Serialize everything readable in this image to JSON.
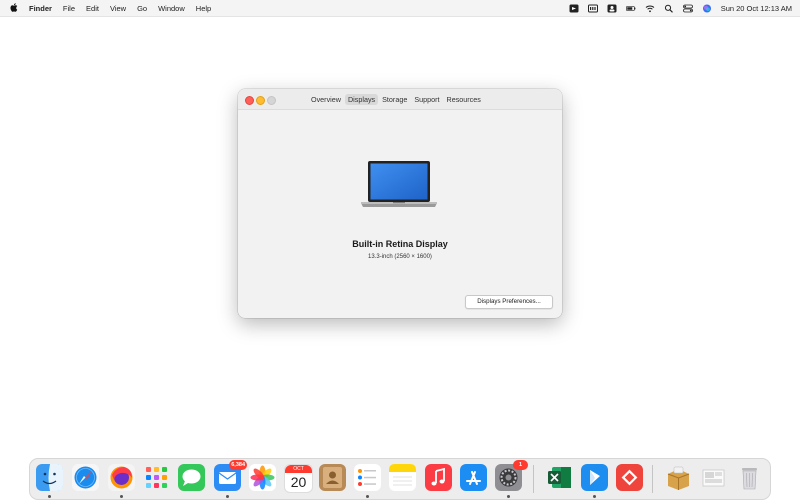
{
  "menubar": {
    "app_name": "Finder",
    "items": [
      "File",
      "Edit",
      "View",
      "Go",
      "Window",
      "Help"
    ],
    "clock": "Sun 20 Oct  12:13 AM"
  },
  "window": {
    "tabs": [
      "Overview",
      "Displays",
      "Storage",
      "Support",
      "Resources"
    ],
    "selected_tab": "Displays",
    "display_name": "Built-in Retina Display",
    "display_spec": "13.3-inch (2560 × 1600)",
    "prefs_button": "Displays Preferences..."
  },
  "dock": {
    "mail_badge": "6,384",
    "settings_badge": "1",
    "calendar_month": "OCT",
    "calendar_day": "20",
    "apps": [
      "Finder",
      "Safari",
      "Firefox",
      "Launchpad",
      "Messages",
      "Mail",
      "Photos",
      "Calendar",
      "Contacts",
      "Reminders",
      "Notes",
      "Music",
      "App Store",
      "System Preferences",
      "Excel",
      "Copilot",
      "AnyDesk",
      "Archive Utility",
      "Preview",
      "Trash"
    ]
  },
  "colors": {
    "close": "#ff5f57",
    "minimize": "#febc2e",
    "badge": "#ff3b30",
    "accent": "#0a84ff"
  }
}
